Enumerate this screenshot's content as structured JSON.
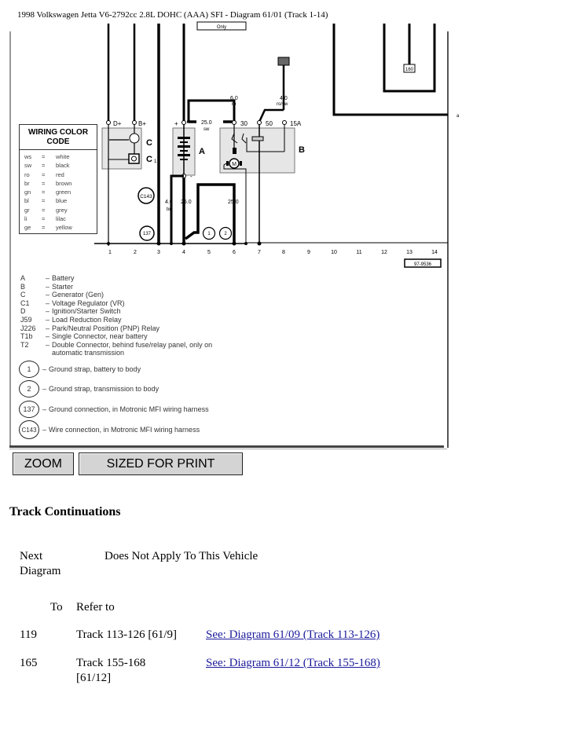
{
  "title": "1998 Volkswagen Jetta V6-2792cc 2.8L DOHC (AAA) SFI - Diagram 61/01 (Track 1-14)",
  "diagram": {
    "wire_labels": {
      "w_25sw_size": "25.0",
      "w_25sw_color": "sw",
      "w_6ro_size": "6.0",
      "w_6ro_color": "ro",
      "w_4rosw_size": "4.0",
      "w_4rosw_color": "ro/sw",
      "w_4br_size": "4.0",
      "w_4br_color": "br",
      "w_25a": "25.0",
      "w_25b": "25.0"
    },
    "terminals": {
      "d_plus": "D+",
      "b_plus": "B+",
      "plus": "+",
      "minus": "-",
      "t30": "30",
      "t50": "50",
      "t15a": "15A"
    },
    "components": {
      "a": "A",
      "b": "B",
      "c": "C",
      "c1": "C",
      "c1_sub": "1",
      "motor": "M"
    },
    "grounds": {
      "g1": "1",
      "g2": "2",
      "g137": "137",
      "c143": "C143"
    },
    "connectors": {
      "t2": "T2",
      "j59": "160"
    },
    "misc": {
      "top_connector": "Only",
      "edge_marker": "a",
      "figure_id": "97-9536"
    },
    "track_numbers": [
      "1",
      "2",
      "3",
      "4",
      "5",
      "6",
      "7",
      "8",
      "9",
      "10",
      "11",
      "12",
      "13",
      "14"
    ]
  },
  "color_code": {
    "title": "WIRING COLOR CODE",
    "rows": [
      {
        "abbr": "ws",
        "eq": "=",
        "color": "white"
      },
      {
        "abbr": "sw",
        "eq": "=",
        "color": "black"
      },
      {
        "abbr": "ro",
        "eq": "=",
        "color": "red"
      },
      {
        "abbr": "br",
        "eq": "=",
        "color": "brown"
      },
      {
        "abbr": "gn",
        "eq": "=",
        "color": "green"
      },
      {
        "abbr": "bl",
        "eq": "=",
        "color": "blue"
      },
      {
        "abbr": "gr",
        "eq": "=",
        "color": "grey"
      },
      {
        "abbr": "li",
        "eq": "=",
        "color": "lilac"
      },
      {
        "abbr": "ge",
        "eq": "=",
        "color": "yellow"
      }
    ]
  },
  "component_key": [
    {
      "code": "A",
      "desc": "Battery"
    },
    {
      "code": "B",
      "desc": "Starter"
    },
    {
      "code": "C",
      "desc": "Generator (Gen)"
    },
    {
      "code": "C1",
      "desc": "Voltage Regulator (VR)"
    },
    {
      "code": "D",
      "desc": "Ignition/Starter Switch"
    },
    {
      "code": "J59",
      "desc": "Load Reduction Relay"
    },
    {
      "code": "J226",
      "desc": "Park/Neutral Position (PNP) Relay"
    },
    {
      "code": "T1b",
      "desc": "Single Connector, near battery"
    },
    {
      "code": "T2",
      "desc": "Double Connector, behind fuse/relay panel, only on",
      "cont": "automatic transmission"
    }
  ],
  "ground_key": [
    {
      "code": "1",
      "desc": "Ground strap, battery to body"
    },
    {
      "code": "2",
      "desc": "Ground strap, transmission to body"
    },
    {
      "code": "137",
      "desc": "Ground connection, in Motronic MFI wiring harness"
    },
    {
      "code": "C143",
      "desc": "Wire connection, in Motronic MFI wiring harness"
    }
  ],
  "key_dash": "–",
  "buttons": {
    "zoom": "ZOOM",
    "print": "SIZED FOR PRINT"
  },
  "track_continuations": {
    "heading": "Track Continuations",
    "next_label": "Next Diagram",
    "next_value": "Does Not Apply To This Vehicle",
    "col_to": "To",
    "col_refer": "Refer to",
    "rows": [
      {
        "to": "119",
        "refer": "Track 113-126 [61/9]",
        "link": "See: Diagram 61/09 (Track 113-126)"
      },
      {
        "to": "165",
        "refer": "Track 155-168 [61/12]",
        "link": "See: Diagram 61/12 (Track 155-168)"
      }
    ]
  }
}
